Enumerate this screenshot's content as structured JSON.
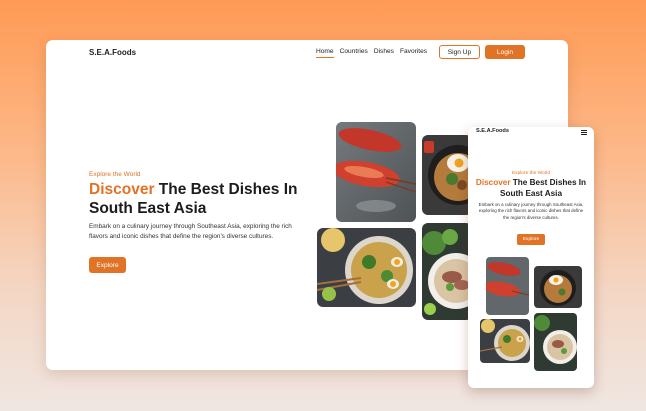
{
  "brand": {
    "accent": "#e07326"
  },
  "desktop": {
    "logo": "S.E.A.Foods",
    "nav": {
      "items": [
        "Home",
        "Countries",
        "Dishes",
        "Favorites"
      ],
      "active": "Home",
      "signup_label": "Sign Up",
      "login_label": "Login"
    },
    "hero": {
      "kicker": "Explore the World",
      "title_accent": "Discover",
      "title_rest": "The Best Dishes In South East Asia",
      "description": "Embark on a culinary journey through Southeast Asia, exploring the rich flavors and iconic dishes that define the region's diverse cultures.",
      "cta_label": "Explore"
    },
    "images": [
      "grilled-lobster",
      "fried-egg-rice-pan",
      "noodle-soup-bowl",
      "pho-bowl"
    ]
  },
  "mobile": {
    "logo": "S.E.A.Foods",
    "menu_icon": "hamburger-menu-icon",
    "hero": {
      "kicker": "Explore the World",
      "title_accent": "Discover",
      "title_rest": "The Best Dishes In South East Asia",
      "description": "Embark on a culinary journey through Southeast Asia, exploring the rich flavors and iconic dishes that define the region's diverse cultures.",
      "cta_label": "Explore"
    },
    "images": [
      "grilled-lobster",
      "fried-egg-rice-pan",
      "noodle-soup-bowl",
      "pho-bowl"
    ]
  }
}
